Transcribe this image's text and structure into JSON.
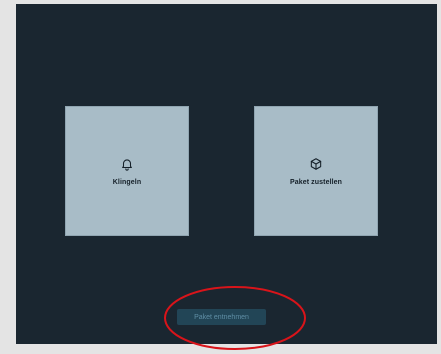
{
  "screen": {
    "background_color": "#1a2630"
  },
  "tiles": [
    {
      "label": "Klingeln",
      "icon": "bell-icon"
    },
    {
      "label": "Paket zustellen",
      "icon": "package-icon"
    }
  ],
  "footer_button": {
    "label": "Paket entnehmen"
  },
  "annotation": {
    "shape": "ellipse",
    "color": "#d9141a",
    "highlights": "Paket entnehmen"
  }
}
